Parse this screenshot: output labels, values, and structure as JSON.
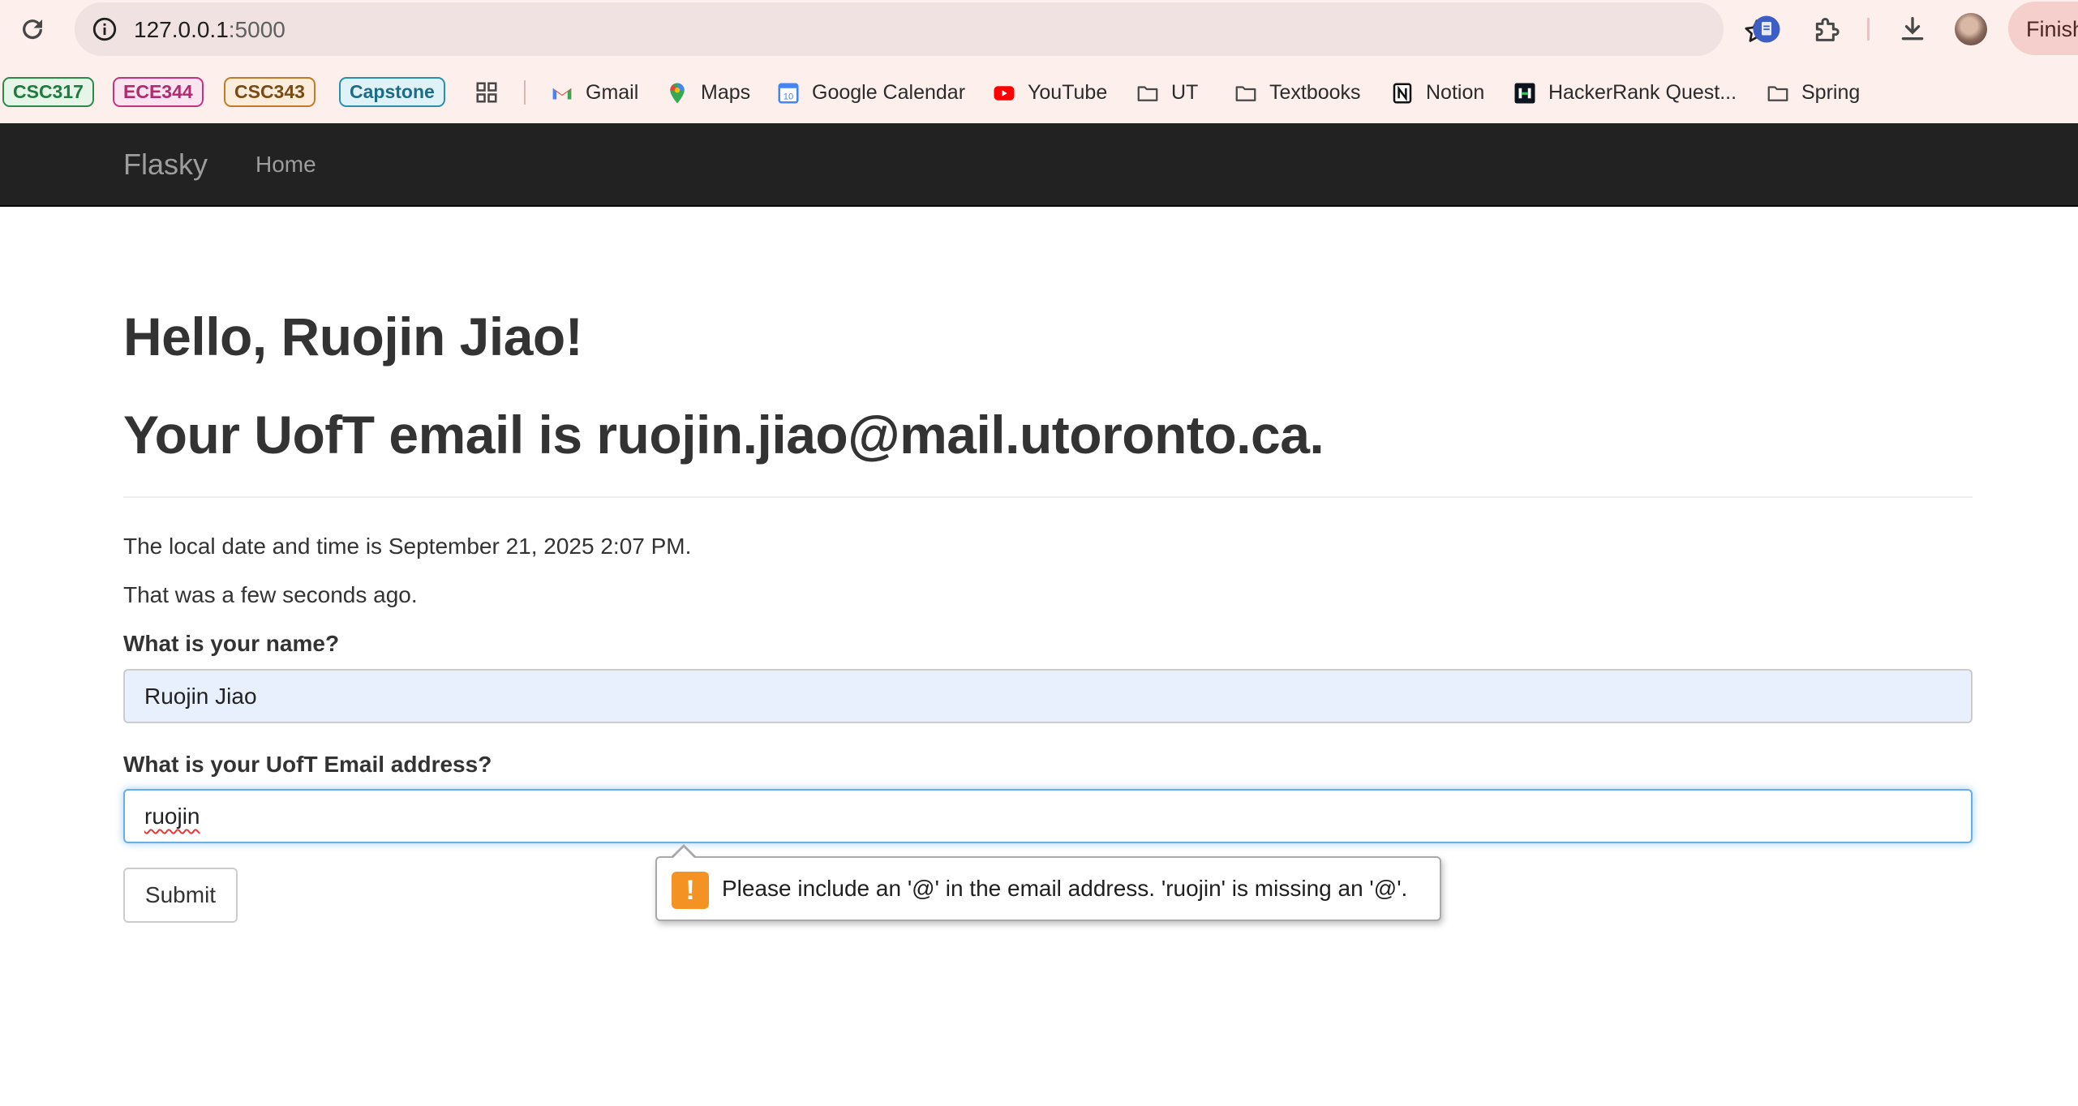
{
  "browser": {
    "url_host": "127.0.0.1",
    "url_port": ":5000",
    "profile_button_label": "Finish",
    "bookmark_chips": [
      "CSC317",
      "ECE344",
      "CSC343",
      "Capstone"
    ],
    "bookmarks": [
      "Gmail",
      "Maps",
      "Google Calendar",
      "YouTube",
      "UT",
      "Textbooks",
      "Notion",
      "HackerRank Quest...",
      "Spring"
    ],
    "calendar_icon_day": "10"
  },
  "navbar": {
    "brand": "Flasky",
    "home": "Home"
  },
  "main": {
    "greeting": "Hello, Ruojin Jiao!",
    "email_line": "Your UofT email is ruojin.jiao@mail.utoronto.ca.",
    "local_time": "The local date and time is September 21, 2025 2:07 PM.",
    "relative_time": "That was a few seconds ago.",
    "name_label": "What is your name?",
    "name_value": "Ruojin Jiao",
    "email_label": "What is your UofT Email address?",
    "email_value": "ruojin",
    "submit_label": "Submit"
  },
  "validation": {
    "icon_glyph": "!",
    "message": "Please include an '@' in the email address. 'ruojin' is missing an '@'.",
    "icon_color": "#f59224"
  },
  "colors": {
    "navbar_bg": "#222222",
    "chrome_bg": "#fcefec",
    "focus_border": "#66afe9",
    "autofill_bg": "#e8f0fe"
  }
}
